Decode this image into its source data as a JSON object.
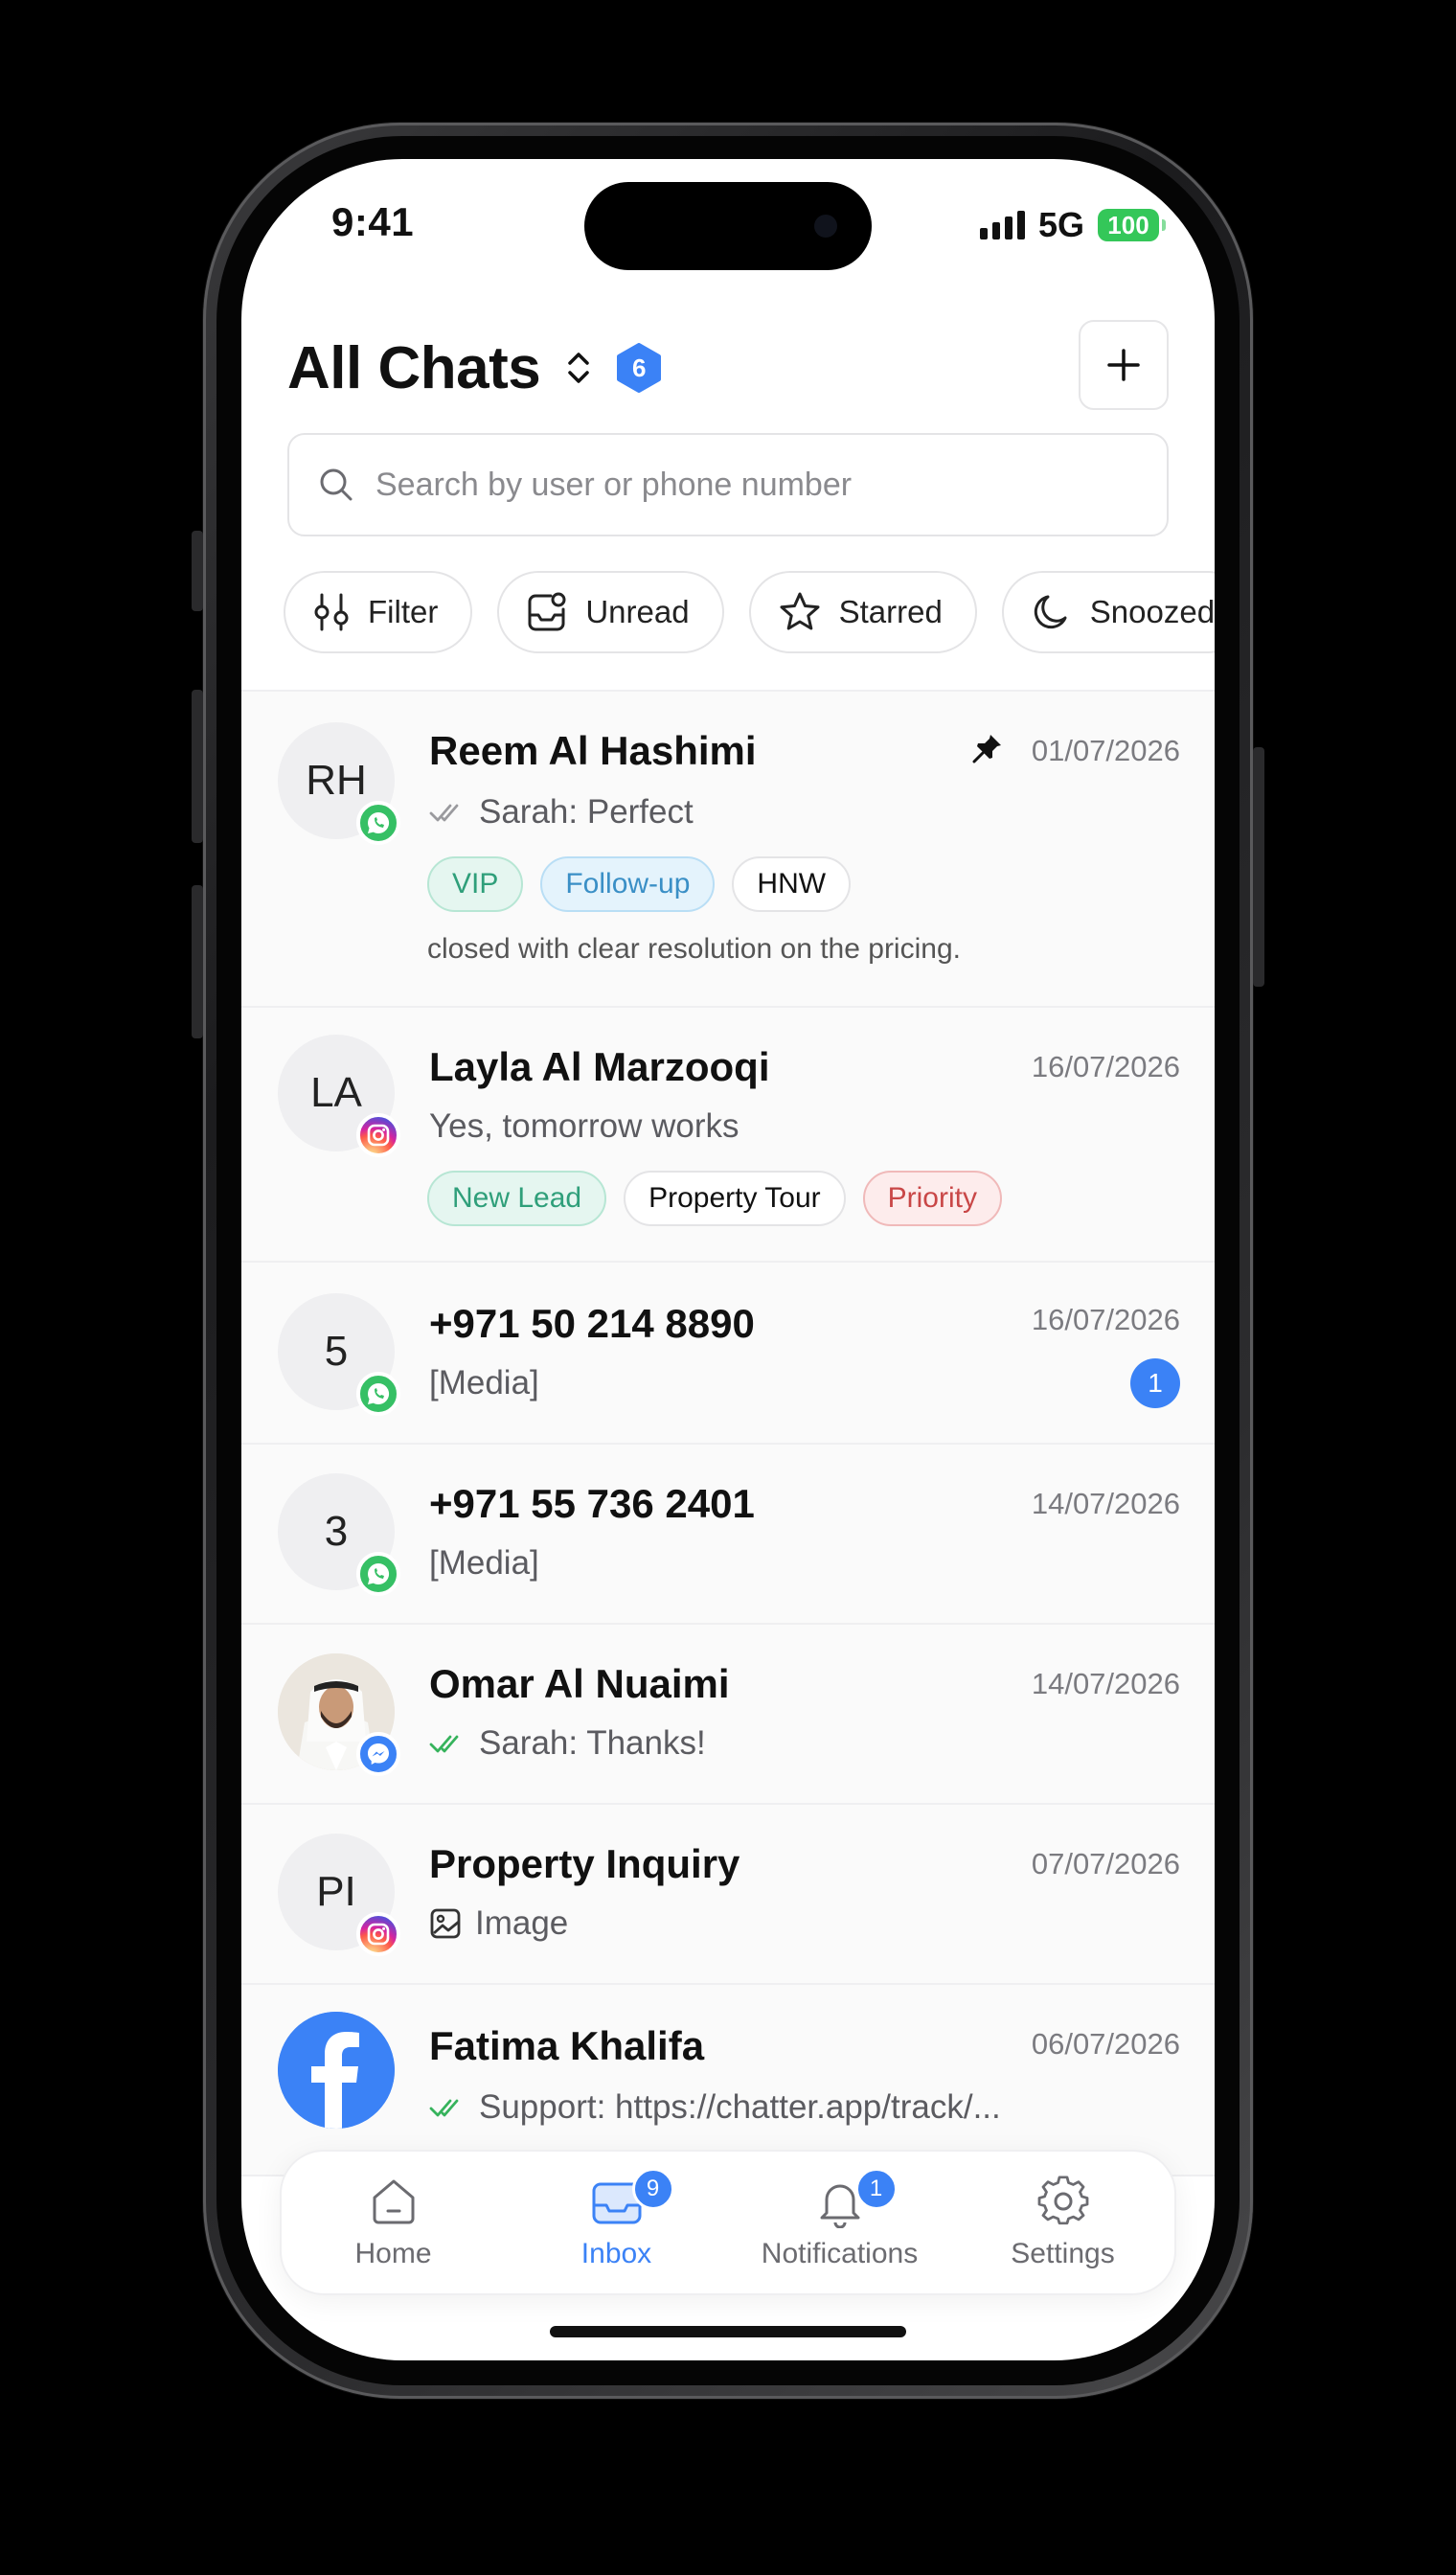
{
  "status_bar": {
    "time": "9:41",
    "network": "5G",
    "battery": "100"
  },
  "header": {
    "title": "All Chats",
    "count": "6"
  },
  "search": {
    "placeholder": "Search by user or phone number"
  },
  "filters": [
    {
      "label": "Filter",
      "icon": "sliders-icon"
    },
    {
      "label": "Unread",
      "icon": "unread-icon"
    },
    {
      "label": "Starred",
      "icon": "star-icon"
    },
    {
      "label": "Snoozed",
      "icon": "moon-icon"
    }
  ],
  "chats": [
    {
      "initials": "RH",
      "channel": "whatsapp",
      "name": "Reem Al Hashimi",
      "date": "01/07/2026",
      "pinned": true,
      "read_status": "read-grey",
      "preview": "Sarah: Perfect",
      "tags": [
        "VIP",
        "Follow-up",
        "HNW"
      ],
      "note": "closed with clear resolution on the pricing."
    },
    {
      "initials": "LA",
      "channel": "instagram",
      "name": "Layla Al Marzooqi",
      "date": "16/07/2026",
      "preview": "Yes, tomorrow works",
      "tags": [
        "New Lead",
        "Property Tour",
        "Priority"
      ]
    },
    {
      "initials": "5",
      "channel": "whatsapp",
      "name": "+971 50 214 8890",
      "date": "16/07/2026",
      "preview": "[Media]",
      "unread": "1"
    },
    {
      "initials": "3",
      "channel": "whatsapp",
      "name": "+971 55 736 2401",
      "date": "14/07/2026",
      "preview": "[Media]"
    },
    {
      "initials": "",
      "channel": "messenger",
      "name": "Omar Al Nuaimi",
      "date": "14/07/2026",
      "read_status": "read-green",
      "preview": "Sarah: Thanks!"
    },
    {
      "initials": "PI",
      "channel": "instagram",
      "name": "Property Inquiry",
      "date": "07/07/2026",
      "preview_icon": "image-icon",
      "preview": "Image"
    },
    {
      "initials": "",
      "channel": "facebook",
      "name": "Fatima Khalifa",
      "date": "06/07/2026",
      "read_status": "read-green",
      "preview": "Support: https://chatter.app/track/..."
    }
  ],
  "nav": [
    {
      "label": "Home",
      "icon": "home-icon"
    },
    {
      "label": "Inbox",
      "icon": "inbox-icon",
      "badge": "9",
      "active": true
    },
    {
      "label": "Notifications",
      "icon": "bell-icon",
      "badge": "1"
    },
    {
      "label": "Settings",
      "icon": "gear-icon"
    }
  ],
  "colors": {
    "accent": "#3b82f6",
    "whatsapp": "#36c065",
    "messenger": "#3b82f6",
    "facebook": "#3b82f6",
    "battery": "#34c759"
  }
}
